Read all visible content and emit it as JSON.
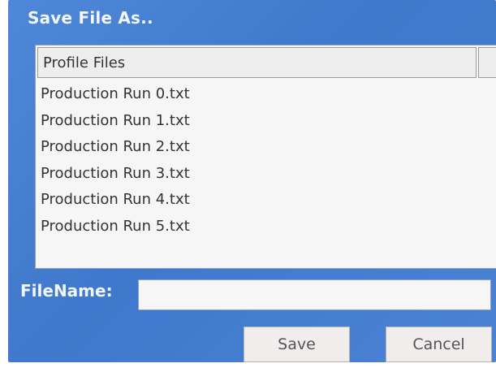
{
  "dialog": {
    "title": "Save File As.."
  },
  "file_list": {
    "header": "Profile Files",
    "items": [
      "Production Run 0.txt",
      "Production Run 1.txt",
      "Production Run 2.txt",
      "Production Run 3.txt",
      "Production Run 4.txt",
      "Production Run 5.txt"
    ]
  },
  "filename": {
    "label": "FileName:",
    "value": ""
  },
  "buttons": {
    "save_label": "Save",
    "cancel_label": "Cancel"
  }
}
